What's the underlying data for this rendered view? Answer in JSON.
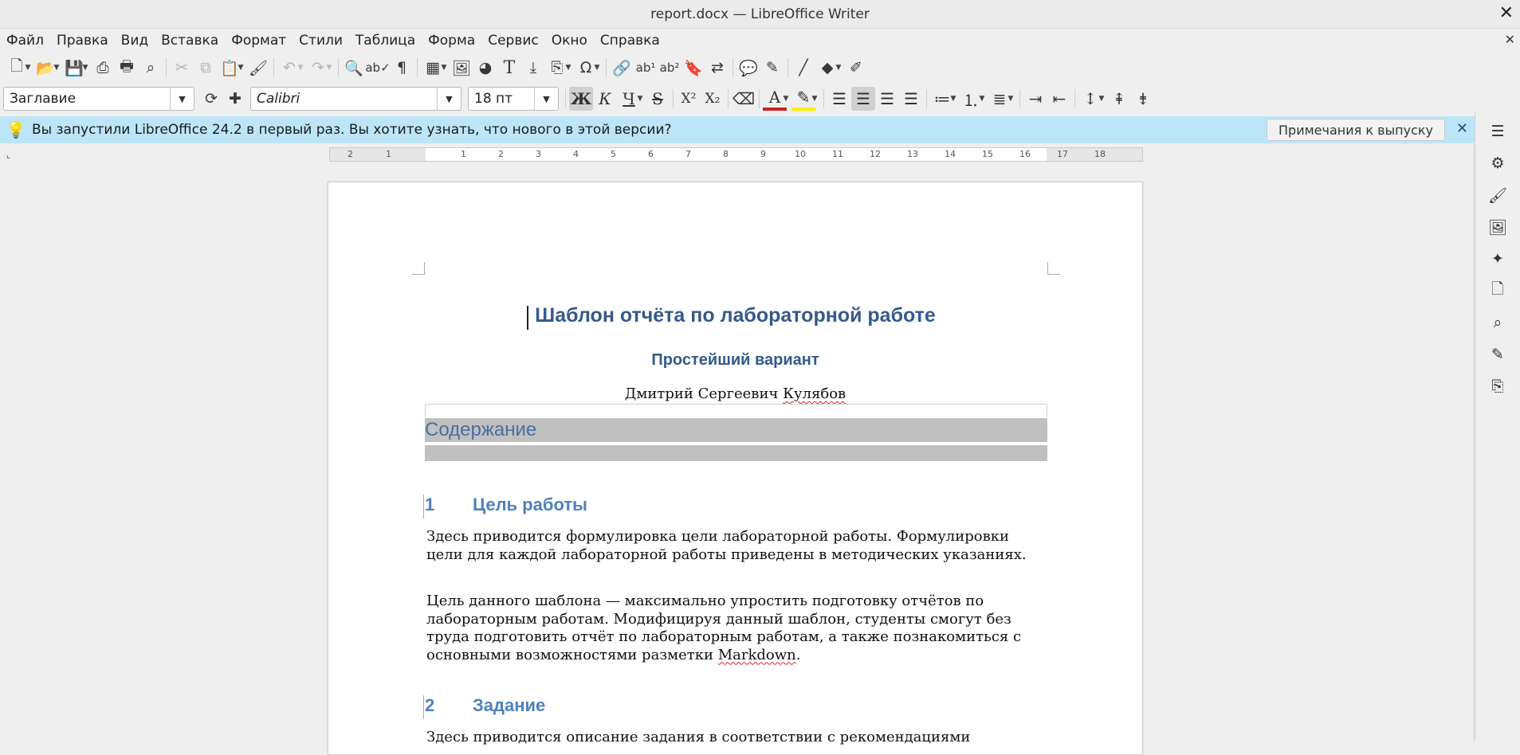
{
  "window": {
    "title": "report.docx — LibreOffice Writer"
  },
  "menu": [
    "Файл",
    "Правка",
    "Вид",
    "Вставка",
    "Формат",
    "Стили",
    "Таблица",
    "Форма",
    "Сервис",
    "Окно",
    "Справка"
  ],
  "format_bar": {
    "paragraph_style": "Заглавие",
    "font_name": "Calibri",
    "font_size": "18 пт"
  },
  "infobar": {
    "message": "Вы запустили LibreOffice 24.2 в первый раз. Вы хотите узнать, что нового в этой версии?",
    "button": "Примечания к выпуску"
  },
  "ruler": {
    "ticks": [
      "2",
      "1",
      "1",
      "2",
      "3",
      "4",
      "5",
      "6",
      "7",
      "8",
      "9",
      "10",
      "11",
      "12",
      "13",
      "14",
      "15",
      "16",
      "17",
      "18"
    ]
  },
  "document": {
    "title": "Шаблон отчёта по лабораторной работе",
    "subtitle": "Простейший вариант",
    "author_first": "Дмитрий Сергеевич ",
    "author_last": "Кулябов",
    "toc_heading": "Содержание",
    "section1": {
      "number": "1",
      "title": "Цель работы",
      "para1": "Здесь приводится формулировка цели лабораторной работы. Формулировки цели для каждой лабораторной работы приведены в методических указаниях.",
      "para2": "Цель данного шаблона — максимально упростить подготовку отчётов по лабораторным работам. Модифицируя данный шаблон, студенты смогут без труда подготовить отчёт по лабораторным работам, а также познакомиться с основными возможностями разметки ",
      "para2_marked": "Markdown",
      "para2_end": "."
    },
    "section2": {
      "number": "2",
      "title": "Задание",
      "para1": "Здесь приводится описание задания в соответствии с рекомендациями"
    }
  }
}
